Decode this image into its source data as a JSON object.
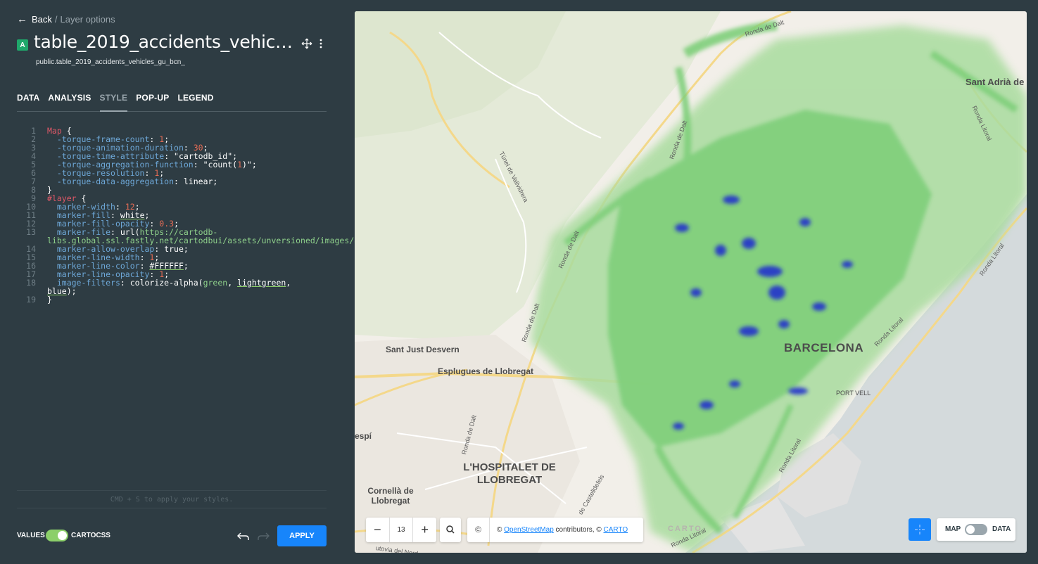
{
  "nav": {
    "back_label": "Back",
    "separator": "/",
    "current": "Layer options"
  },
  "layer": {
    "badge": "A",
    "title": "table_2019_accidents_vehicles_gu_bcn_",
    "source": "public.table_2019_accidents_vehicles_gu_bcn_"
  },
  "tabs": [
    "DATA",
    "ANALYSIS",
    "STYLE",
    "POP-UP",
    "LEGEND"
  ],
  "active_tab": "STYLE",
  "editor": {
    "line_numbers": [
      "1",
      "2",
      "3",
      "4",
      "5",
      "6",
      "7",
      "8",
      "9",
      "10",
      "11",
      "12",
      "13",
      "14",
      "15",
      "16",
      "17",
      "18",
      "19"
    ],
    "hint": "CMD + S to apply your styles."
  },
  "footer": {
    "values_label": "VALUES",
    "cartocss_label": "CARTOCSS",
    "apply_label": "APPLY"
  },
  "map": {
    "zoom_level": "13",
    "attribution_prefix": "©",
    "attribution_osm": "OpenStreetMap",
    "attribution_mid": "contributors, ©",
    "attribution_carto": "CARTO",
    "watermark": "CARTO",
    "toggle_map_label": "MAP",
    "toggle_data_label": "DATA",
    "places": {
      "sant_adria": "Sant Adrià de Besòs",
      "barcelona": "BARCELONA",
      "sant_just": "Sant Just Desvern",
      "esplugues": "Esplugues de Llobregat",
      "hospitalet": "L'HOSPITALET DE LLOBREGAT",
      "cornella": "Cornellà de Llobregat",
      "port_vell": "PORT VELL",
      "espi": "espí"
    },
    "roads": {
      "ronda_dalt": "Ronda de Dalt",
      "ronda_litoral": "Ronda Litoral",
      "tunel": "Túnel de Vallvidrera",
      "castelldefels": "de Castelldefels",
      "nord_est": "utovia del Nord-est"
    }
  },
  "colors": {
    "accent": "#1785fb",
    "panel_bg": "#2e3c43",
    "heat_green": "#7fcf7a",
    "heat_blue": "#2233cc",
    "toggle_on": "#8ccf6a"
  }
}
